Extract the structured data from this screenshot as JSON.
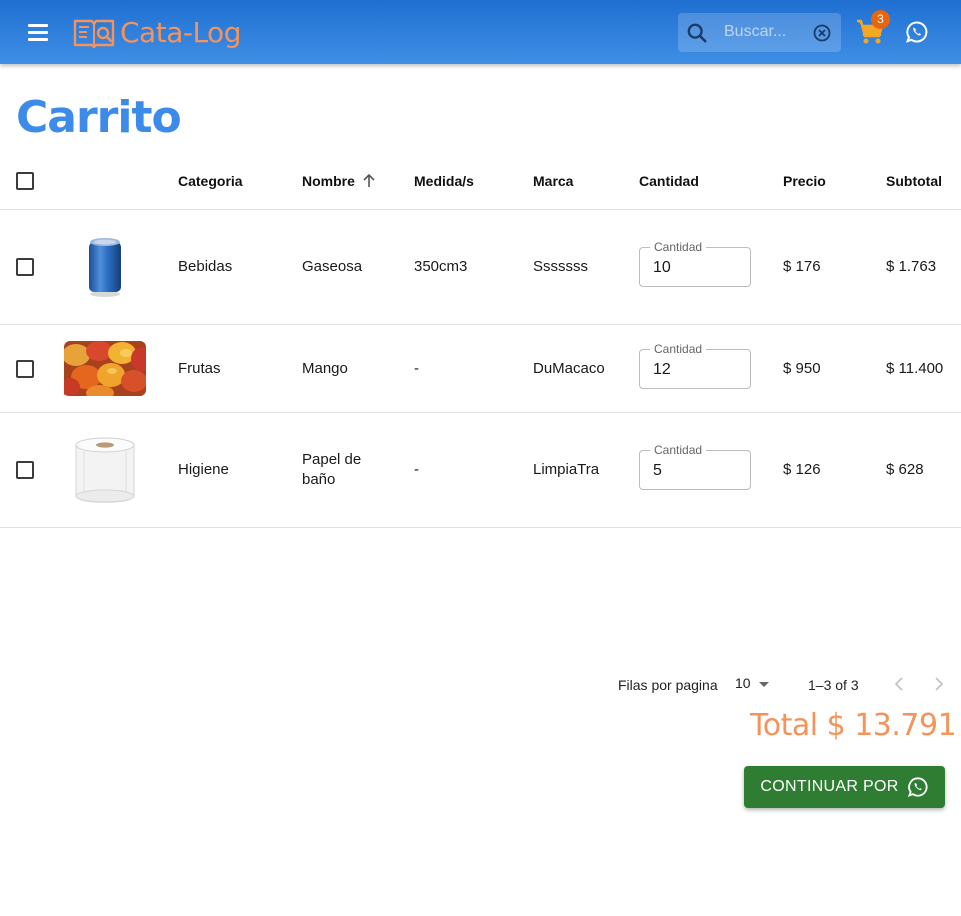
{
  "header": {
    "brand": "Cata-Log",
    "search_placeholder": "Buscar...",
    "cart_count": "3"
  },
  "page": {
    "title": "Carrito"
  },
  "table": {
    "columns": {
      "categoria": "Categoria",
      "nombre": "Nombre",
      "medida": "Medida/s",
      "marca": "Marca",
      "cantidad": "Cantidad",
      "precio": "Precio",
      "subtotal": "Subtotal"
    },
    "quantity_label": "Cantidad",
    "rows": [
      {
        "categoria": "Bebidas",
        "nombre": "Gaseosa",
        "nombre_line2": "",
        "medida": "350cm3",
        "marca": "Sssssss",
        "cantidad": "10",
        "precio": "$ 176",
        "subtotal": "$ 1.763"
      },
      {
        "categoria": "Frutas",
        "nombre": "Mango",
        "nombre_line2": "",
        "medida": "-",
        "marca": "DuMacaco",
        "cantidad": "12",
        "precio": "$ 950",
        "subtotal": "$ 11.400"
      },
      {
        "categoria": "Higiene",
        "nombre": "Papel de",
        "nombre_line2": "baño",
        "medida": "-",
        "marca": "LimpiaTra",
        "cantidad": "5",
        "precio": "$ 126",
        "subtotal": "$ 628"
      }
    ]
  },
  "pagination": {
    "rows_label": "Filas por pagina",
    "rows_per_page": "10",
    "range": "1–3 of 3"
  },
  "summary": {
    "total": "Total $ 13.791",
    "continue_label": "CONTINUAR POR"
  },
  "colors": {
    "header": "#1f6fd1",
    "accent_orange": "#f5935a",
    "title_blue": "#3d8be8",
    "button_green": "#2e7d32",
    "badge": "#e8650d"
  },
  "icons": {
    "menu": "menu-icon",
    "logo": "book-search-icon",
    "search": "search-icon",
    "clear": "close-circle-icon",
    "cart": "shopping-cart-icon",
    "whatsapp": "whatsapp-icon",
    "sort": "arrow-up-icon",
    "prev": "chevron-left-icon",
    "next": "chevron-right-icon"
  }
}
